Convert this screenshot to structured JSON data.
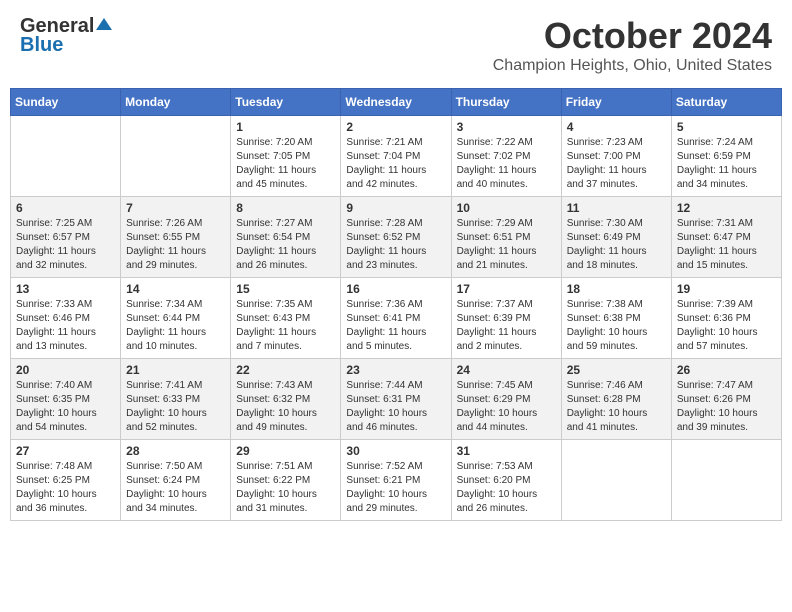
{
  "header": {
    "logo_general": "General",
    "logo_blue": "Blue",
    "month_title": "October 2024",
    "location": "Champion Heights, Ohio, United States"
  },
  "days_of_week": [
    "Sunday",
    "Monday",
    "Tuesday",
    "Wednesday",
    "Thursday",
    "Friday",
    "Saturday"
  ],
  "weeks": [
    [
      {
        "day": "",
        "info": ""
      },
      {
        "day": "",
        "info": ""
      },
      {
        "day": "1",
        "info": "Sunrise: 7:20 AM\nSunset: 7:05 PM\nDaylight: 11 hours and 45 minutes."
      },
      {
        "day": "2",
        "info": "Sunrise: 7:21 AM\nSunset: 7:04 PM\nDaylight: 11 hours and 42 minutes."
      },
      {
        "day": "3",
        "info": "Sunrise: 7:22 AM\nSunset: 7:02 PM\nDaylight: 11 hours and 40 minutes."
      },
      {
        "day": "4",
        "info": "Sunrise: 7:23 AM\nSunset: 7:00 PM\nDaylight: 11 hours and 37 minutes."
      },
      {
        "day": "5",
        "info": "Sunrise: 7:24 AM\nSunset: 6:59 PM\nDaylight: 11 hours and 34 minutes."
      }
    ],
    [
      {
        "day": "6",
        "info": "Sunrise: 7:25 AM\nSunset: 6:57 PM\nDaylight: 11 hours and 32 minutes."
      },
      {
        "day": "7",
        "info": "Sunrise: 7:26 AM\nSunset: 6:55 PM\nDaylight: 11 hours and 29 minutes."
      },
      {
        "day": "8",
        "info": "Sunrise: 7:27 AM\nSunset: 6:54 PM\nDaylight: 11 hours and 26 minutes."
      },
      {
        "day": "9",
        "info": "Sunrise: 7:28 AM\nSunset: 6:52 PM\nDaylight: 11 hours and 23 minutes."
      },
      {
        "day": "10",
        "info": "Sunrise: 7:29 AM\nSunset: 6:51 PM\nDaylight: 11 hours and 21 minutes."
      },
      {
        "day": "11",
        "info": "Sunrise: 7:30 AM\nSunset: 6:49 PM\nDaylight: 11 hours and 18 minutes."
      },
      {
        "day": "12",
        "info": "Sunrise: 7:31 AM\nSunset: 6:47 PM\nDaylight: 11 hours and 15 minutes."
      }
    ],
    [
      {
        "day": "13",
        "info": "Sunrise: 7:33 AM\nSunset: 6:46 PM\nDaylight: 11 hours and 13 minutes."
      },
      {
        "day": "14",
        "info": "Sunrise: 7:34 AM\nSunset: 6:44 PM\nDaylight: 11 hours and 10 minutes."
      },
      {
        "day": "15",
        "info": "Sunrise: 7:35 AM\nSunset: 6:43 PM\nDaylight: 11 hours and 7 minutes."
      },
      {
        "day": "16",
        "info": "Sunrise: 7:36 AM\nSunset: 6:41 PM\nDaylight: 11 hours and 5 minutes."
      },
      {
        "day": "17",
        "info": "Sunrise: 7:37 AM\nSunset: 6:39 PM\nDaylight: 11 hours and 2 minutes."
      },
      {
        "day": "18",
        "info": "Sunrise: 7:38 AM\nSunset: 6:38 PM\nDaylight: 10 hours and 59 minutes."
      },
      {
        "day": "19",
        "info": "Sunrise: 7:39 AM\nSunset: 6:36 PM\nDaylight: 10 hours and 57 minutes."
      }
    ],
    [
      {
        "day": "20",
        "info": "Sunrise: 7:40 AM\nSunset: 6:35 PM\nDaylight: 10 hours and 54 minutes."
      },
      {
        "day": "21",
        "info": "Sunrise: 7:41 AM\nSunset: 6:33 PM\nDaylight: 10 hours and 52 minutes."
      },
      {
        "day": "22",
        "info": "Sunrise: 7:43 AM\nSunset: 6:32 PM\nDaylight: 10 hours and 49 minutes."
      },
      {
        "day": "23",
        "info": "Sunrise: 7:44 AM\nSunset: 6:31 PM\nDaylight: 10 hours and 46 minutes."
      },
      {
        "day": "24",
        "info": "Sunrise: 7:45 AM\nSunset: 6:29 PM\nDaylight: 10 hours and 44 minutes."
      },
      {
        "day": "25",
        "info": "Sunrise: 7:46 AM\nSunset: 6:28 PM\nDaylight: 10 hours and 41 minutes."
      },
      {
        "day": "26",
        "info": "Sunrise: 7:47 AM\nSunset: 6:26 PM\nDaylight: 10 hours and 39 minutes."
      }
    ],
    [
      {
        "day": "27",
        "info": "Sunrise: 7:48 AM\nSunset: 6:25 PM\nDaylight: 10 hours and 36 minutes."
      },
      {
        "day": "28",
        "info": "Sunrise: 7:50 AM\nSunset: 6:24 PM\nDaylight: 10 hours and 34 minutes."
      },
      {
        "day": "29",
        "info": "Sunrise: 7:51 AM\nSunset: 6:22 PM\nDaylight: 10 hours and 31 minutes."
      },
      {
        "day": "30",
        "info": "Sunrise: 7:52 AM\nSunset: 6:21 PM\nDaylight: 10 hours and 29 minutes."
      },
      {
        "day": "31",
        "info": "Sunrise: 7:53 AM\nSunset: 6:20 PM\nDaylight: 10 hours and 26 minutes."
      },
      {
        "day": "",
        "info": ""
      },
      {
        "day": "",
        "info": ""
      }
    ]
  ]
}
